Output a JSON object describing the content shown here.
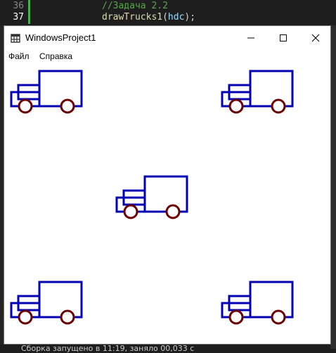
{
  "editor": {
    "lines": [
      {
        "num": "36",
        "text": "//Задача 2.2"
      },
      {
        "num": "37",
        "fn": "drawTrucks1",
        "open": "(",
        "arg": "hdc",
        "close": ");"
      }
    ],
    "status_text": "Сборка запущено в 11:19, заняло 00,033 с"
  },
  "window": {
    "title": "WindowsProject1",
    "menu": [
      "Файл",
      "Справка"
    ],
    "buttons": {
      "minimize": "minimize-icon",
      "maximize": "maximize-icon",
      "close": "close-icon"
    }
  },
  "drawing": {
    "truck_color": "#0000b4",
    "wheel_color": "#6b0000",
    "truck_count": 5
  }
}
